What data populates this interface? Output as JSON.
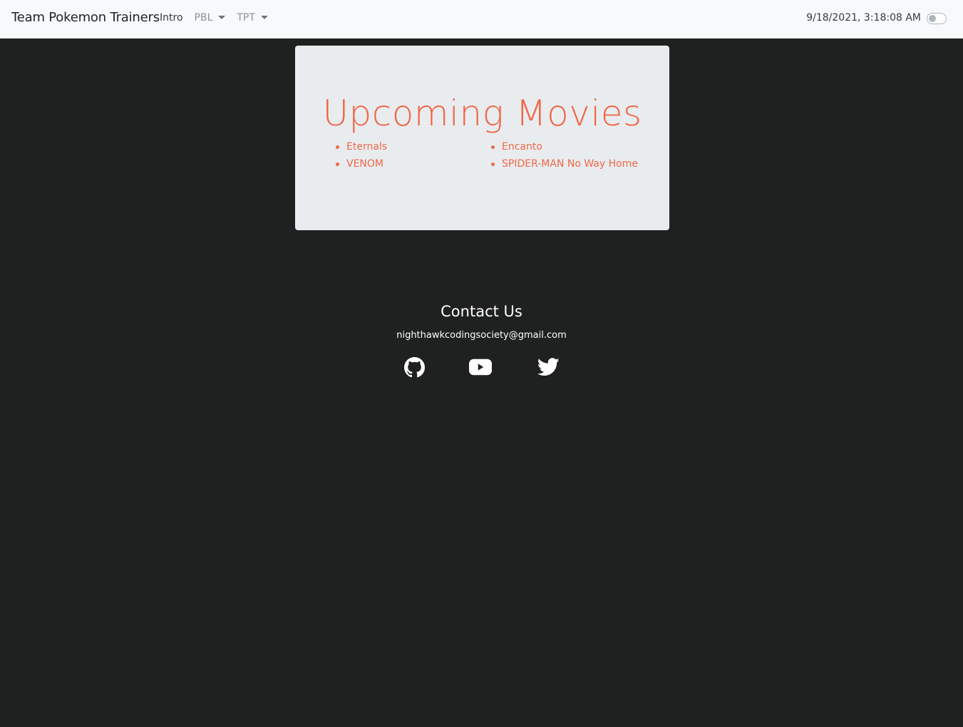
{
  "navbar": {
    "brand": "Team Pokemon Trainers",
    "links": [
      {
        "label": "Intro"
      },
      {
        "label": "PBL"
      },
      {
        "label": "TPT"
      }
    ],
    "clock": "9/18/2021, 3:18:08 AM"
  },
  "jumbotron": {
    "title": "Upcoming Movies",
    "left_movies": [
      "Eternals",
      "VENOM"
    ],
    "right_movies": [
      "Encanto",
      "SPIDER-MAN No Way Home"
    ]
  },
  "footer": {
    "title": "Contact Us",
    "email": "nighthawkcodingsociety@gmail.com",
    "icons": [
      "github-icon",
      "youtube-icon",
      "twitter-icon"
    ]
  },
  "colors": {
    "background": "#1f2020",
    "navbar": "#f8f9fa",
    "jumbotron": "#e9ecef",
    "accent": "#f06748",
    "footer_text": "#ffffff"
  }
}
